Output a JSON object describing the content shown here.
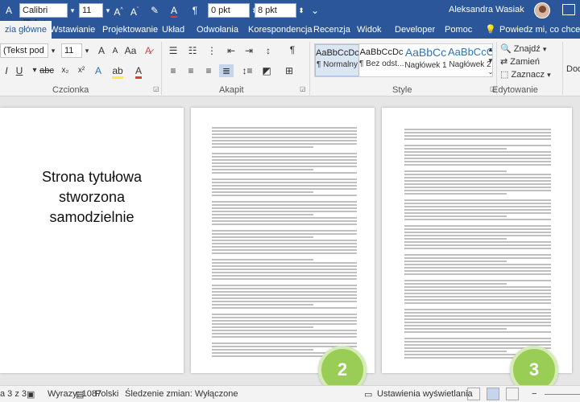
{
  "quick_access": {
    "font_name": "Calibri (Tekst",
    "font_size": "11",
    "spacing_before": "0 pkt",
    "spacing_after": "8 pkt"
  },
  "user": {
    "name": "Aleksandra Wasiak"
  },
  "tabs": [
    {
      "label": "zia główne",
      "active": true
    },
    {
      "label": "Wstawianie"
    },
    {
      "label": "Projektowanie"
    },
    {
      "label": "Układ"
    },
    {
      "label": "Odwołania"
    },
    {
      "label": "Korespondencja"
    },
    {
      "label": "Recenzja"
    },
    {
      "label": "Widok"
    },
    {
      "label": "Developer"
    },
    {
      "label": "Pomoc"
    },
    {
      "label": "Powiedz mi, co chcesz zro"
    }
  ],
  "ribbon": {
    "font_name": "(Tekst pod",
    "font_size": "11",
    "group_font": "Czcionka",
    "group_paragraph": "Akapit",
    "group_styles": "Style",
    "group_editing": "Edytowanie",
    "styles": [
      {
        "sample": "AaBbCcDc",
        "name": "¶ Normalny",
        "selected": true
      },
      {
        "sample": "AaBbCcDc",
        "name": "¶ Bez odst..."
      },
      {
        "sample": "AaBbCc",
        "name": "Nagłówek 1",
        "big": true
      },
      {
        "sample": "AaBbCcC",
        "name": "Nagłówek 2",
        "big": true
      }
    ],
    "editing": {
      "find": "Znajdź",
      "replace": "Zamień",
      "select": "Zaznacz"
    },
    "extra": "Dod"
  },
  "document": {
    "title_page_text": [
      "Strona tytułowa",
      "stworzona",
      "samodzielnie"
    ],
    "page_badges": [
      "2",
      "3"
    ]
  },
  "statusbar": {
    "page": "a 3 z 3",
    "words": "Wyrazy: 1087",
    "language": "Polski",
    "track_changes": "Śledzenie zmian: Wyłączone",
    "display_settings": "Ustawienia wyświetlania"
  },
  "colors": {
    "accent": "#2b579a",
    "badge": "#9acd55"
  }
}
